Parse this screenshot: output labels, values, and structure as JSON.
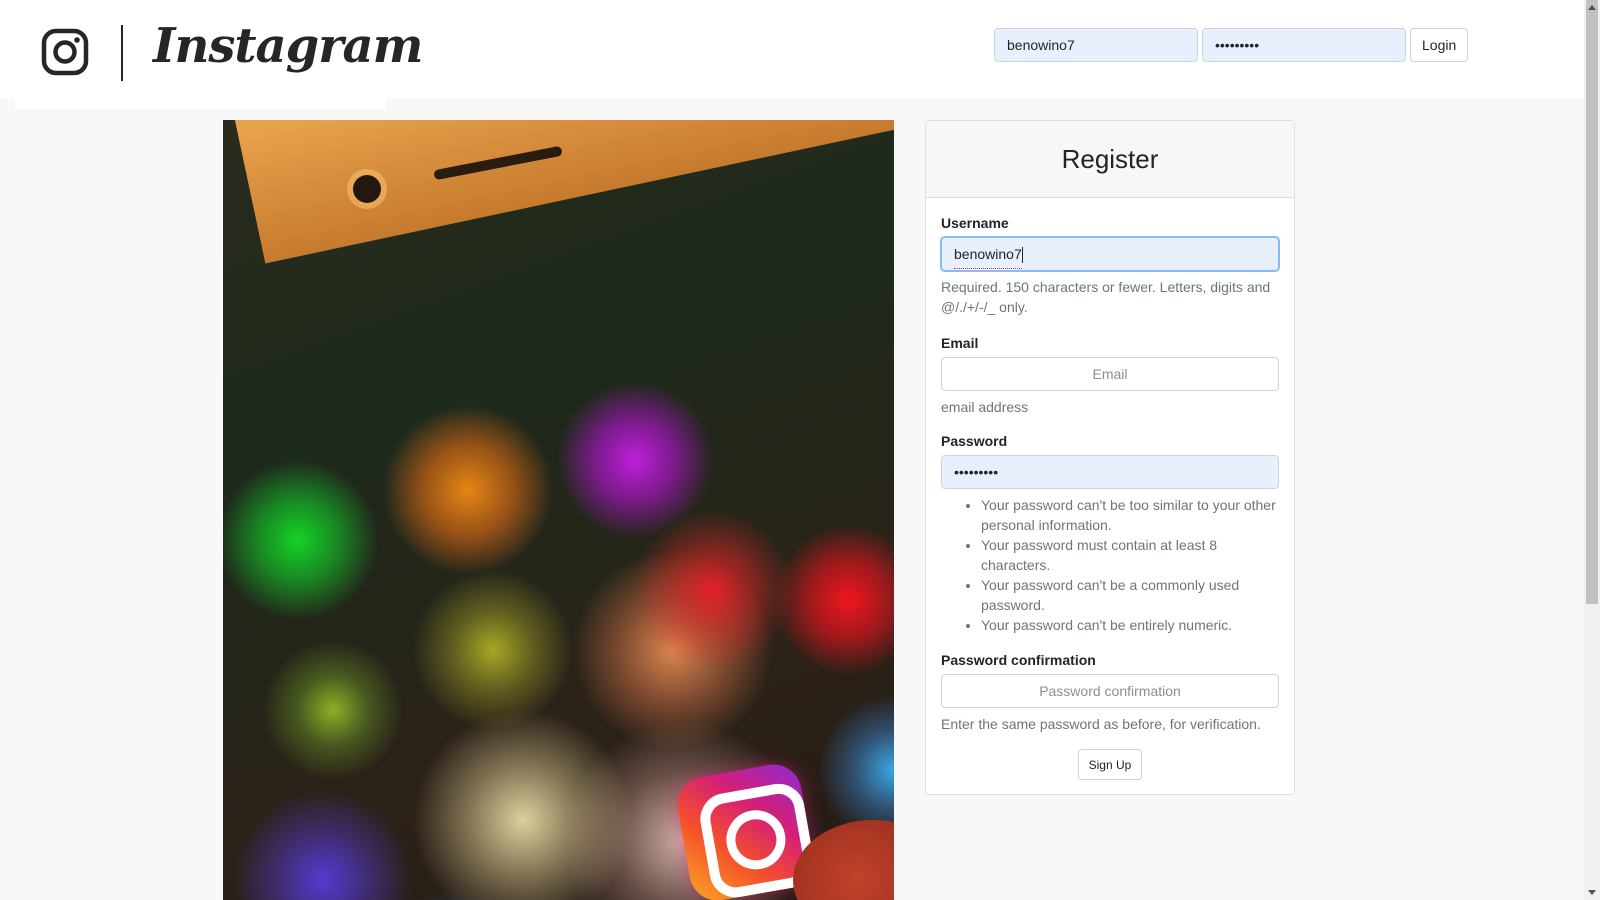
{
  "brand": {
    "wordmark": "Instagram",
    "logo_icon": "camera-glyph-icon"
  },
  "login": {
    "username_value": "benowino7",
    "password_value": "•••••••••",
    "login_label": "Login"
  },
  "hero": {
    "image_icon": "instagram-app-photo"
  },
  "register": {
    "title": "Register",
    "username": {
      "label": "Username",
      "value": "benowino7",
      "help": "Required. 150 characters or fewer. Letters, digits and @/./+/-/_ only."
    },
    "email": {
      "label": "Email",
      "placeholder": "Email",
      "help": "email address"
    },
    "password": {
      "label": "Password",
      "value": "•••••••••",
      "help_items": [
        "Your password can't be too similar to your other personal information.",
        "Your password must contain at least 8 characters.",
        "Your password can't be a commonly used password.",
        "Your password can't be entirely numeric."
      ]
    },
    "password_confirmation": {
      "label": "Password confirmation",
      "placeholder": "Password confirmation",
      "help": "Enter the same password as before, for verification."
    },
    "signup_label": "Sign Up"
  },
  "colors": {
    "page_background": "#f7f8f7",
    "autofill_background": "#e8f0fe",
    "focus_border": "#80bdff",
    "help_text": "#6c757d"
  }
}
